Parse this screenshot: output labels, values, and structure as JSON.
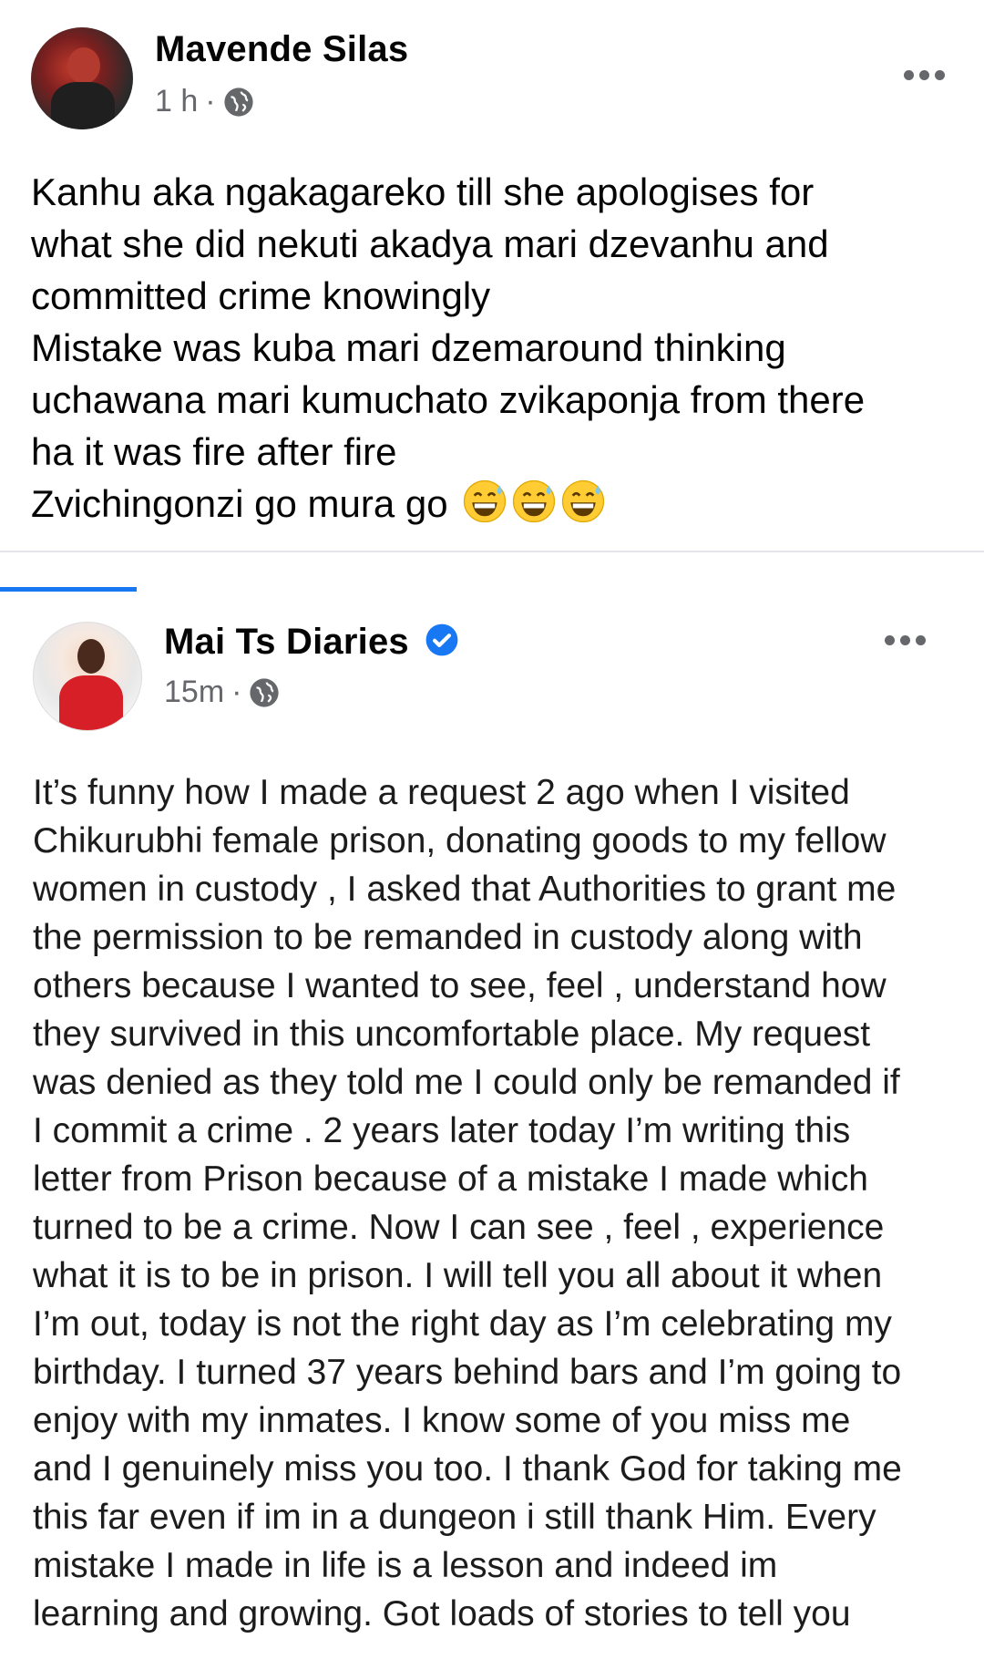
{
  "posts": [
    {
      "author": "Mavende Silas",
      "time": "1 h",
      "separator": "·",
      "privacy_icon": "globe-icon",
      "body_lines": [
        "Kanhu aka ngakagareko till she apologises for",
        "what she did nekuti akadya mari dzevanhu and",
        "committed crime knowingly",
        "Mistake was kuba mari dzemaround thinking",
        "uchawana mari kumuchato zvikaponja from there",
        "ha it was fire after fire",
        "Zvichingonzi go mura go"
      ],
      "emojis": [
        "grinning-sweat-emoji",
        "grinning-sweat-emoji",
        "grinning-sweat-emoji"
      ]
    },
    {
      "author": "Mai Ts Diaries",
      "verified": true,
      "time": "15m",
      "separator": "·",
      "privacy_icon": "globe-icon",
      "body_lines": [
        "It’s funny how I made a request 2 ago when I visited",
        "Chikurubhi female prison, donating goods to my fellow",
        "women in custody , I asked that Authorities to grant me",
        "the permission to be remanded in custody along with",
        "others because I wanted to see, feel , understand how",
        "they survived in this uncomfortable place. My request",
        "was denied as they told me I could only be remanded if",
        "I commit a crime . 2 years later today I’m writing this",
        "letter from Prison because of a mistake I made which",
        "turned to be a crime. Now I can see , feel , experience",
        "what it is to be in prison. I will tell you all about it when",
        "I’m out, today is not the right day as I’m celebrating my",
        "birthday. I turned 37 years behind bars and I’m going to",
        "enjoy with my inmates. I know some of you miss me",
        "and I genuinely miss you too. I thank God for taking me",
        "this far even if im in a dungeon i still thank Him. Every",
        "mistake I made in life is a lesson and indeed im",
        "learning and growing. Got loads of stories to tell you"
      ]
    }
  ],
  "colors": {
    "accent": "#1877f2",
    "meta_text": "#65676b",
    "divider": "#e4e6eb"
  }
}
